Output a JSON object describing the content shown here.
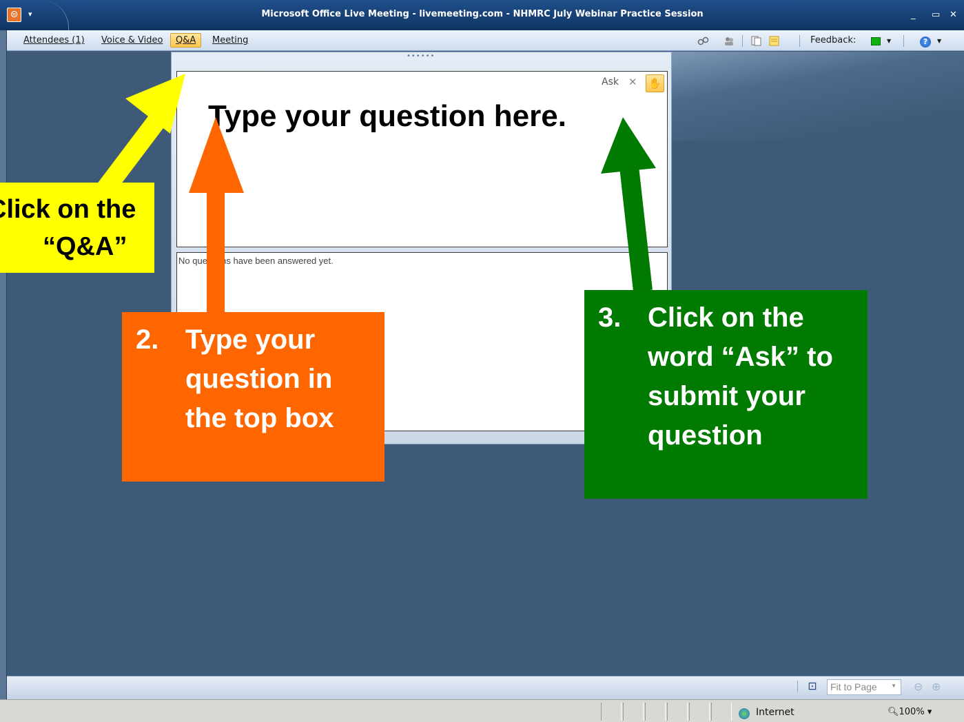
{
  "window": {
    "title": "Microsoft Office Live Meeting - livemeeting.com - NHMRC July Webinar Practice Session",
    "minimize": "_",
    "maximize": "▭",
    "close": "✕"
  },
  "menu": {
    "attendees": "Attendees (1)",
    "voice_video": "Voice & Video",
    "qa": "Q&A",
    "meeting": "Meeting",
    "feedback_label": "Feedback:",
    "feedback_color": "#10b010"
  },
  "qa_panel": {
    "ask_label": "Ask",
    "ask_prompt": "Type your question here.",
    "answers_text": "No questions have been answered yet."
  },
  "bottom_bar": {
    "fit_option": "Fit to Page"
  },
  "statusbar": {
    "zone": "Internet",
    "zoom": "100%"
  },
  "annotations": {
    "step1_line1": "Click on the",
    "step1_line2": "“Q&A”",
    "step2_num": "2.",
    "step2_text": "Type your question in the top box",
    "step3_num": "3.",
    "step3_text": "Click on the word “Ask” to submit your question",
    "colors": {
      "yellow": "#ffff00",
      "orange": "#ff6600",
      "green": "#007a00"
    }
  }
}
